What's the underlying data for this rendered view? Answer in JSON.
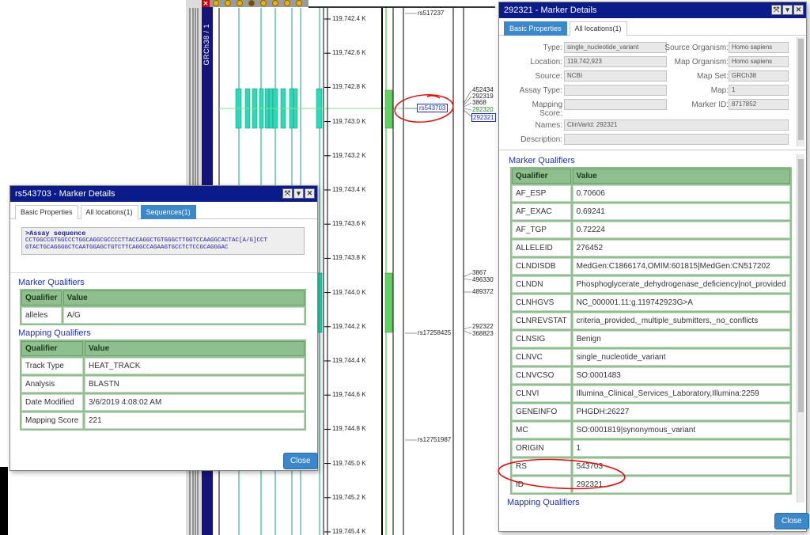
{
  "app": {
    "chromosome_label": "GRCh38 / 1",
    "close_glyph": "✕"
  },
  "ruler": {
    "ticks": [
      "119,742.4 K",
      "119,742.6 K",
      "119,742.8 K",
      "119,743.0 K",
      "119,743.2 K",
      "119,743.4 K",
      "119,743.6 K",
      "119,743.8 K",
      "119,744.0 K",
      "119,744.2 K",
      "119,744.4 K",
      "119,744.6 K",
      "119,744.8 K",
      "119,745.0 K",
      "119,745.2 K",
      "119,745.4 K"
    ]
  },
  "markers": {
    "rs517237": "rs517237",
    "rs543703": "rs543703",
    "rs17258425": "rs17258425",
    "rs12751987": "rs12751987",
    "ids_top": [
      "452434",
      "292319",
      "3868",
      "292320",
      "292321"
    ],
    "ids_mid": [
      "3867",
      "496330"
    ],
    "id_489372": "489372",
    "ids_low": [
      "292322",
      "368823"
    ]
  },
  "left_popup": {
    "title": "rs543703 - Marker Details",
    "tabs": [
      "Basic Properties",
      "All locations(1)",
      "Sequences(1)"
    ],
    "active_tab": 2,
    "sequence_header": ">Assay sequence",
    "sequence_line1": "CCTGGCCGTGGCCCTGGCAGGCGCCCCTTACCAGGCTGTGGGCTTGGTCCAAGGCACTAC[A/G]CCT",
    "sequence_line2": "GTACTGCAGGGGCTCAATGGAGCTGTCTTCAGGCCAGAAGTGCCTCTCCGCAGGGAC",
    "marker_qualifiers_title": "Marker Qualifiers",
    "mapping_qualifiers_title": "Mapping Qualifiers",
    "header_qualifier": "Qualifier",
    "header_value": "Value",
    "marker_rows": [
      {
        "q": "alleles",
        "v": "A/G"
      }
    ],
    "mapping_rows": [
      {
        "q": "Track Type",
        "v": "HEAT_TRACK"
      },
      {
        "q": "Analysis",
        "v": "BLASTN"
      },
      {
        "q": "Date Modified",
        "v": "3/6/2019 4:08:02 AM"
      },
      {
        "q": "Mapping Score",
        "v": "221"
      }
    ],
    "close_label": "Close"
  },
  "right_popup": {
    "title": "292321 - Marker Details",
    "tabs": [
      "Basic Properties",
      "All locations(1)"
    ],
    "active_tab": 0,
    "fields": {
      "type_label": "Type:",
      "type": "single_nucleotide_variant",
      "source_org_label": "Source Organism:",
      "source_org": "Homo sapiens",
      "location_label": "Location:",
      "location": "119,742,923",
      "map_org_label": "Map Organism:",
      "map_org": "Homo sapiens",
      "source_label": "Source:",
      "source": "NCBI",
      "map_set_label": "Map Set:",
      "map_set": "GRCh38",
      "assay_label": "Assay Type:",
      "assay": "",
      "map_label": "Map:",
      "map": "1",
      "mapping_score_label": "Mapping Score:",
      "mapping_score": "",
      "marker_id_label": "Marker ID:",
      "marker_id": "8717852",
      "names_label": "Names:",
      "names": "ClinVarId: 292321",
      "description_label": "Description:",
      "description": ""
    },
    "marker_qualifiers_title": "Marker Qualifiers",
    "mapping_qualifiers_title": "Mapping Qualifiers",
    "header_qualifier": "Qualifier",
    "header_value": "Value",
    "rows": [
      {
        "q": "AF_ESP",
        "v": "0.70606"
      },
      {
        "q": "AF_EXAC",
        "v": "0.69241"
      },
      {
        "q": "AF_TGP",
        "v": "0.72224"
      },
      {
        "q": "ALLELEID",
        "v": "276452"
      },
      {
        "q": "CLNDISDB",
        "v": "MedGen:C1866174,OMIM:601815|MedGen:CN517202"
      },
      {
        "q": "CLNDN",
        "v": "Phosphoglycerate_dehydrogenase_deficiency|not_provided"
      },
      {
        "q": "CLNHGVS",
        "v": "NC_000001.11:g.119742923G>A"
      },
      {
        "q": "CLNREVSTAT",
        "v": "criteria_provided,_multiple_submitters,_no_conflicts"
      },
      {
        "q": "CLNSIG",
        "v": "Benign"
      },
      {
        "q": "CLNVC",
        "v": "single_nucleotide_variant"
      },
      {
        "q": "CLNVCSO",
        "v": "SO:0001483"
      },
      {
        "q": "CLNVI",
        "v": "Illumina_Clinical_Services_Laboratory,Illumina:2259"
      },
      {
        "q": "GENEINFO",
        "v": "PHGDH:26227"
      },
      {
        "q": "MC",
        "v": "SO:0001819|synonymous_variant"
      },
      {
        "q": "ORIGIN",
        "v": "1"
      },
      {
        "q": "RS",
        "v": "543703"
      },
      {
        "q": "ID",
        "v": "292321"
      }
    ],
    "close_label": "Close"
  },
  "colors": {
    "title_bar": "#0c1b8a",
    "tab_active": "#3b87c9",
    "qualifier_table": "#8fbe8f",
    "annotation_red": "#e01010",
    "feature_teal": "#2fd9b8",
    "feature_green": "#5ed35e"
  }
}
